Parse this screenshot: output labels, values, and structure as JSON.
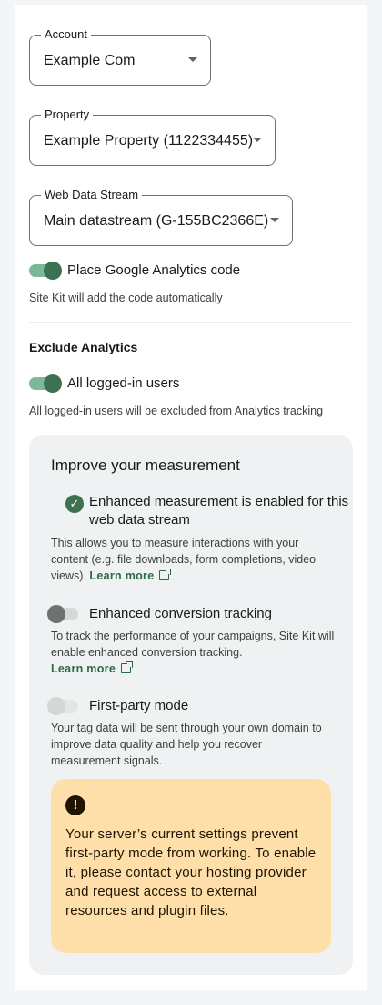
{
  "account": {
    "label": "Account",
    "value": "Example Com"
  },
  "property": {
    "label": "Property",
    "value": "Example Property (1122334455)"
  },
  "stream": {
    "label": "Web Data Stream",
    "value": "Main datastream (G-155BC2366E)"
  },
  "place_code": {
    "label": "Place Google Analytics code",
    "help": "Site Kit will add the code automatically",
    "enabled": true
  },
  "exclude": {
    "heading": "Exclude Analytics",
    "label": "All logged-in users",
    "help": "All logged-in users will be excluded from Analytics tracking",
    "enabled": true
  },
  "measurement": {
    "title": "Improve your measurement",
    "enhanced": {
      "text": "Enhanced measurement is enabled for this web data stream",
      "help": "This allows you to measure interactions with your content (e.g. file downloads, form completions, video views).",
      "link": "Learn more"
    },
    "conversion": {
      "label": "Enhanced conversion tracking",
      "help": "To track the performance of your campaigns, Site Kit will enable enhanced conversion tracking.",
      "link": "Learn more",
      "enabled": false
    },
    "first_party": {
      "label": "First-party mode",
      "help": "Your tag data will be sent through your own domain to improve data quality and help you recover measurement signals.",
      "enabled": false
    },
    "notice": {
      "icon": "warning-icon",
      "text": "Your server’s current settings prevent first-party mode from working. To enable it, please contact your hosting provider and request access to external resources and plugin files."
    }
  },
  "colors": {
    "accent": "#3c7251",
    "link": "#2b6b43",
    "warning_bg": "#ffdfa9"
  }
}
